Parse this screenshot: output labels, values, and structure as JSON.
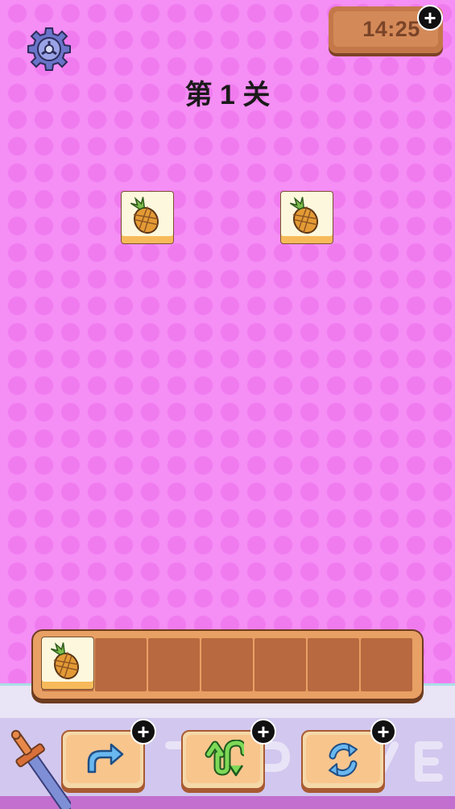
{
  "header": {
    "timer": "14:25",
    "level_title": "第 1 关"
  },
  "board": {
    "tiles": [
      {
        "icon": "pineapple-icon"
      },
      {
        "icon": "pineapple-icon"
      }
    ]
  },
  "tray": {
    "slot_count": 7,
    "filled": [
      {
        "icon": "pineapple-icon"
      }
    ]
  },
  "tools": [
    {
      "name": "undo",
      "icon": "undo-arrow-icon"
    },
    {
      "name": "swap",
      "icon": "swap-arrows-icon"
    },
    {
      "name": "shuffle",
      "icon": "shuffle-refresh-icon"
    }
  ],
  "colors": {
    "background": "#f58ef5",
    "tile_face": "#fdf8dd",
    "tile_edge": "#f7ba5b",
    "tray": "#e8a064",
    "slot": "#b8693f",
    "timer_text": "#7a4428",
    "tool_icon": "#3a8fd6",
    "swap_icon": "#6cc24a"
  }
}
